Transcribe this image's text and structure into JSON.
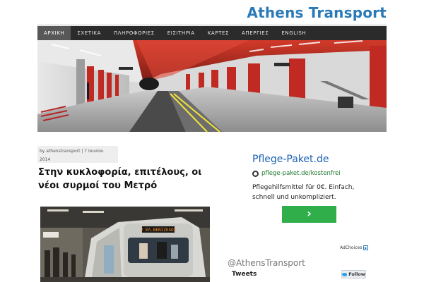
{
  "site": {
    "title": "Athens Transport"
  },
  "nav": {
    "items": [
      "ΑΡΧΙΚΗ",
      "ΣΧΕΤΙΚΑ",
      "ΠΛΗΡΟΦΟΡΙΕΣ",
      "ΕΙΣΙΤΗΡΙΑ",
      "ΚΑΡΤΕΣ",
      "ΑΠΕΡΓΙΕΣ",
      "ENGLISH"
    ],
    "active": "ΑΡΧΙΚΗ"
  },
  "post": {
    "meta_line1": "by athenstransport | 7 Ιουνίου",
    "meta_line2": "2014",
    "title": "Στην κυκλοφορία, επιτέλους, οι νέοι συρμοί του Μετρό",
    "train_display": "2 ΕΛ.ΒΕΝΙΖΕΛΟΣ"
  },
  "ad": {
    "title": "Pflege-Paket.de",
    "url": "pflege-paket.de/kostenfrei",
    "description": "Pflegehilfsmittel für 0€. Einfach, schnell und unkompliziert.",
    "button_icon": "chevron-right-icon",
    "adchoices": "AdChoices"
  },
  "twitter": {
    "handle": "@AthensTransport",
    "tweets_label": "Tweets",
    "follow_label": "Follow"
  },
  "colors": {
    "brand": "#2a7ab8",
    "nav_bg": "#2b2b2b",
    "ad_button": "#2fae4a"
  }
}
